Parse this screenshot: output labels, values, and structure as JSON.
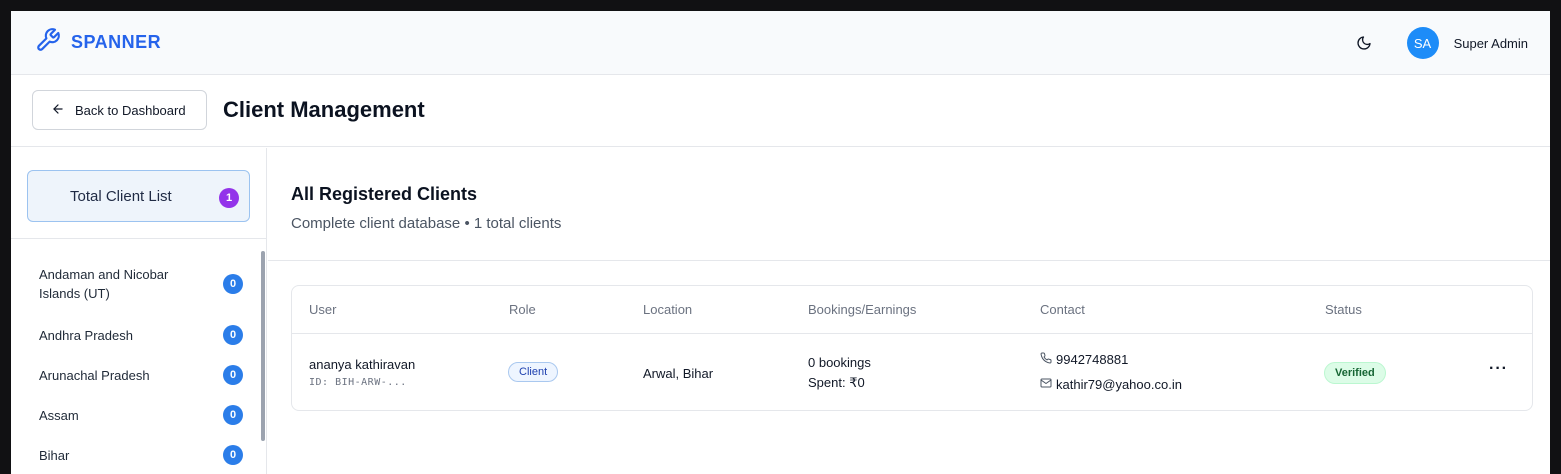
{
  "brand": {
    "name": "SPANNER",
    "icon": "wrench-icon",
    "color": "#2563eb"
  },
  "topbar": {
    "theme_icon": "moon-icon",
    "avatar_initials": "SA",
    "user_name": "Super Admin"
  },
  "page": {
    "back_label": "Back to Dashboard",
    "title": "Client Management"
  },
  "sidebar": {
    "total_label": "Total Client List",
    "total_count": "1",
    "states": [
      {
        "name": "Andaman and Nicobar Islands (UT)",
        "count": "0"
      },
      {
        "name": "Andhra Pradesh",
        "count": "0"
      },
      {
        "name": "Arunachal Pradesh",
        "count": "0"
      },
      {
        "name": "Assam",
        "count": "0"
      },
      {
        "name": "Bihar",
        "count": "0"
      }
    ]
  },
  "main": {
    "title": "All Registered Clients",
    "subtitle": "Complete client database • 1 total clients",
    "columns": [
      "User",
      "Role",
      "Location",
      "Bookings/Earnings",
      "Contact",
      "Status"
    ],
    "rows": [
      {
        "name": "ananya kathiravan",
        "id": "ID: BIH-ARW-...",
        "role": "Client",
        "location": "Arwal, Bihar",
        "bookings": "0 bookings",
        "spent": "Spent: ₹0",
        "phone": "9942748881",
        "email": "kathir79@yahoo.co.in",
        "status": "Verified",
        "actions": "···"
      }
    ]
  },
  "colors": {
    "accent": "#2563eb",
    "badge_blue": "#2b7de9",
    "badge_purple": "#9333ea",
    "verified_bg": "#dcfce7",
    "verified_text": "#166534"
  }
}
